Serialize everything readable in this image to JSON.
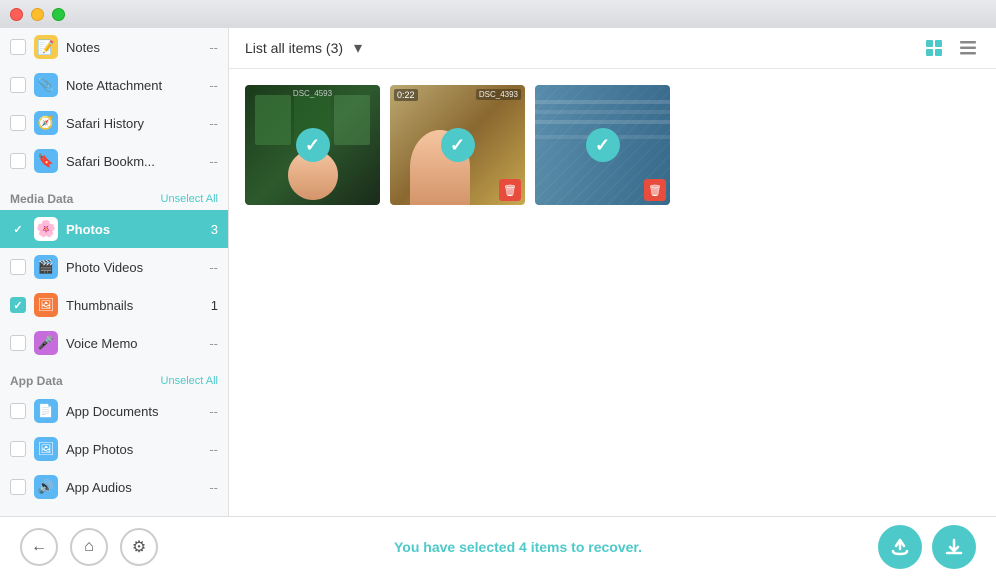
{
  "titlebar": {
    "buttons": [
      "close",
      "minimize",
      "maximize"
    ]
  },
  "sidebar": {
    "sections": [
      {
        "id": "app-data-top",
        "items": [
          {
            "id": "notes",
            "label": "Notes",
            "icon": "notes-icon",
            "checked": false,
            "value": "--",
            "active": false
          },
          {
            "id": "note-attachment",
            "label": "Note Attachment",
            "icon": "attach-icon",
            "checked": false,
            "value": "--",
            "active": false
          },
          {
            "id": "safari-history",
            "label": "Safari History",
            "icon": "safari-icon",
            "checked": false,
            "value": "--",
            "active": false
          },
          {
            "id": "safari-bookmarks",
            "label": "Safari Bookm...",
            "icon": "bookmark-icon",
            "checked": false,
            "value": "--",
            "active": false
          }
        ]
      },
      {
        "id": "media-data",
        "title": "Media Data",
        "action": "Unselect All",
        "items": [
          {
            "id": "photos",
            "label": "Photos",
            "icon": "photos-icon",
            "checked": true,
            "value": "3",
            "active": true
          },
          {
            "id": "photo-videos",
            "label": "Photo Videos",
            "icon": "video-icon",
            "checked": false,
            "value": "--",
            "active": false
          },
          {
            "id": "thumbnails",
            "label": "Thumbnails",
            "icon": "thumb-icon",
            "checked": true,
            "value": "1",
            "active": false
          },
          {
            "id": "voice-memo",
            "label": "Voice Memo",
            "icon": "voice-icon",
            "checked": false,
            "value": "--",
            "active": false
          }
        ]
      },
      {
        "id": "app-data",
        "title": "App Data",
        "action": "Unselect All",
        "items": [
          {
            "id": "app-documents",
            "label": "App Documents",
            "icon": "doc-icon",
            "checked": false,
            "value": "--",
            "active": false
          },
          {
            "id": "app-photos",
            "label": "App Photos",
            "icon": "appphotos-icon",
            "checked": false,
            "value": "--",
            "active": false
          },
          {
            "id": "app-audios",
            "label": "App Audios",
            "icon": "audio-icon",
            "checked": false,
            "value": "--",
            "active": false
          }
        ]
      }
    ]
  },
  "toolbar": {
    "title": "List all items (3)",
    "dropdown_icon": "▾",
    "view_grid_label": "grid-view",
    "view_list_label": "list-view"
  },
  "photos": [
    {
      "id": "photo-1",
      "label": "DSC_4593",
      "duration": null,
      "checked": true,
      "hasDelete": false
    },
    {
      "id": "photo-2",
      "label": "DSC_4393",
      "duration": "0:22",
      "checked": true,
      "hasDelete": true
    },
    {
      "id": "photo-3",
      "label": null,
      "duration": null,
      "checked": true,
      "hasDelete": true
    }
  ],
  "bottombar": {
    "status_pre": "You have selected ",
    "status_count": "4",
    "status_post": " items to recover.",
    "nav": {
      "back_label": "←",
      "home_label": "⌂",
      "settings_label": "⚙"
    },
    "actions": {
      "recover_label": "↩",
      "download_label": "↓"
    }
  }
}
